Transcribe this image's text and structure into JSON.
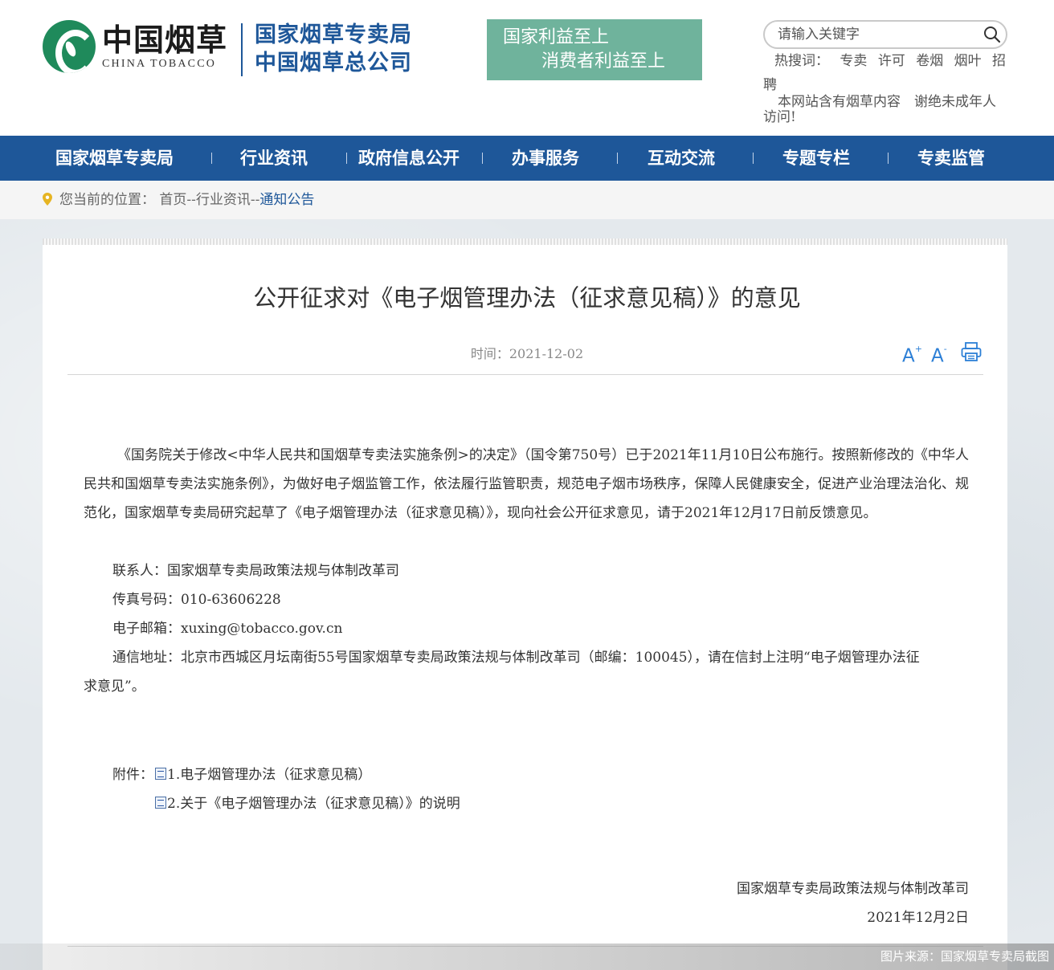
{
  "header": {
    "logo_cn": "中国烟草",
    "logo_en": "CHINA TOBACCO",
    "org_line1": "国家烟草专卖局",
    "org_line2": "中国烟草总公司",
    "slogan_line1": "国家利益至上",
    "slogan_line2": "消费者利益至上",
    "search_placeholder": "请输入关键字",
    "hot_label": "热搜词：",
    "hot_keywords": [
      "专卖",
      "许可",
      "卷烟",
      "烟叶",
      "招",
      "聘"
    ],
    "notice": "本网站含有烟草内容　谢绝未成年人访问!"
  },
  "nav": {
    "items": [
      "国家烟草专卖局",
      "行业资讯",
      "政府信息公开",
      "办事服务",
      "互动交流",
      "专题专栏",
      "专卖监管"
    ]
  },
  "breadcrumb": {
    "prefix": "您当前的位置：",
    "home": "首页",
    "sep": "--",
    "section": "行业资讯",
    "current": "通知公告"
  },
  "article": {
    "title": "公开征求对《电子烟管理办法（征求意见稿）》的意见",
    "date_label": "时间：",
    "date": "2021-12-02",
    "font_increase": "A",
    "font_decrease": "A",
    "body": "《国务院关于修改<中华人民共和国烟草专卖法实施条例>的决定》（国令第750号）已于2021年11月10日公布施行。按照新修改的《中华人民共和国烟草专卖法实施条例》，为做好电子烟监管工作，依法履行监管职责，规范电子烟市场秩序，保障人民健康安全，促进产业治理法治化、规范化，国家烟草专卖局研究起草了《电子烟管理办法（征求意见稿）》，现向社会公开征求意见，请于2021年12月17日前反馈意见。",
    "contact": "联系人：国家烟草专卖局政策法规与体制改革司",
    "fax": "传真号码：010-63606228",
    "email": "电子邮箱：xuxing@tobacco.gov.cn",
    "address_line1": "通信地址：北京市西城区月坛南街55号国家烟草专卖局政策法规与体制改革司（邮编：100045），请在信封上注明“电子烟管理办法征",
    "address_line2": "求意见”。",
    "attach_label": "附件：",
    "attachments": [
      "1.电子烟管理办法（征求意见稿）",
      "2.关于《电子烟管理办法（征求意见稿）》的说明"
    ],
    "signature": "国家烟草专卖局政策法规与体制改革司",
    "sign_date": "2021年12月2日"
  },
  "credit": "图片来源：国家烟草专卖局截图",
  "colors": {
    "brand_blue": "#1e5799",
    "brand_green": "#1f8a5b",
    "slogan_bg": "#6fb39c"
  }
}
